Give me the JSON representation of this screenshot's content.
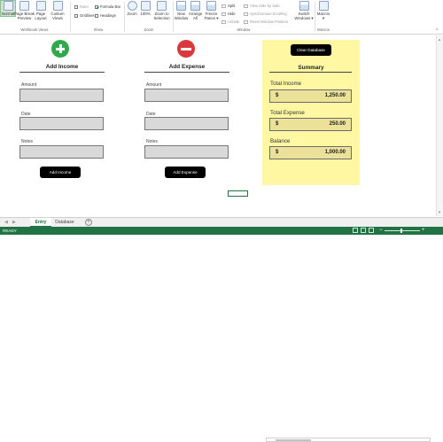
{
  "ribbon": {
    "normal": "Normal",
    "page_break": "Page Break\nPreview",
    "page_layout": "Page\nLayout",
    "custom_views": "Custom\nViews",
    "ruler": "Ruler",
    "formula_bar": "Formula Bar",
    "gridlines": "Gridlines",
    "headings": "Headings",
    "zoom": "Zoom",
    "zoom_100": "100%",
    "zoom_selection": "Zoom to\nSelection",
    "new_window": "New\nWindow",
    "arrange_all": "Arrange\nAll",
    "freeze_panes": "Freeze\nPanes ▾",
    "split": "Split",
    "hide": "Hide",
    "unhide": "Unhide",
    "view_side": "View Side by Side",
    "sync_scroll": "Synchronous Scrolling",
    "reset_pos": "Reset Window Position",
    "switch_windows": "Switch\nWindows ▾",
    "macros": "Macros\n▾",
    "groups": {
      "workbook_views": "Workbook Views",
      "show": "Show",
      "zoom": "Zoom",
      "window": "Window",
      "macros": "Macros"
    }
  },
  "form": {
    "income": {
      "title": "Add Income",
      "amount_label": "Amount",
      "date_label": "Date",
      "notes_label": "Notes",
      "button": "Add Income"
    },
    "expense": {
      "title": "Add Expense",
      "amount_label": "Amount",
      "date_label": "Date",
      "notes_label": "Notes",
      "button": "Add Expense"
    },
    "clear_button": "Clear Database",
    "summary": {
      "title": "Summary",
      "total_income_label": "Total Income",
      "total_income_currency": "$",
      "total_income_value": "1,250.00",
      "total_expense_label": "Total Expense",
      "total_expense_currency": "$",
      "total_expense_value": "250.00",
      "balance_label": "Balance",
      "balance_currency": "$",
      "balance_value": "1,000.00"
    }
  },
  "sheets": {
    "tabs": [
      "Entry",
      "Database"
    ],
    "active": "Entry",
    "add_symbol": "+",
    "prev_arrow": "◀",
    "next_arrow": "▶"
  },
  "statusbar": {
    "status": "READY",
    "zoom_minus": "−",
    "zoom_plus": "+",
    "zoom_level": ""
  },
  "colors": {
    "excel_green": "#217346",
    "summary_bg": "#fff7a1",
    "summary_box": "#ebe198",
    "add_green": "#31a84a",
    "remove_red": "#d9383c"
  }
}
